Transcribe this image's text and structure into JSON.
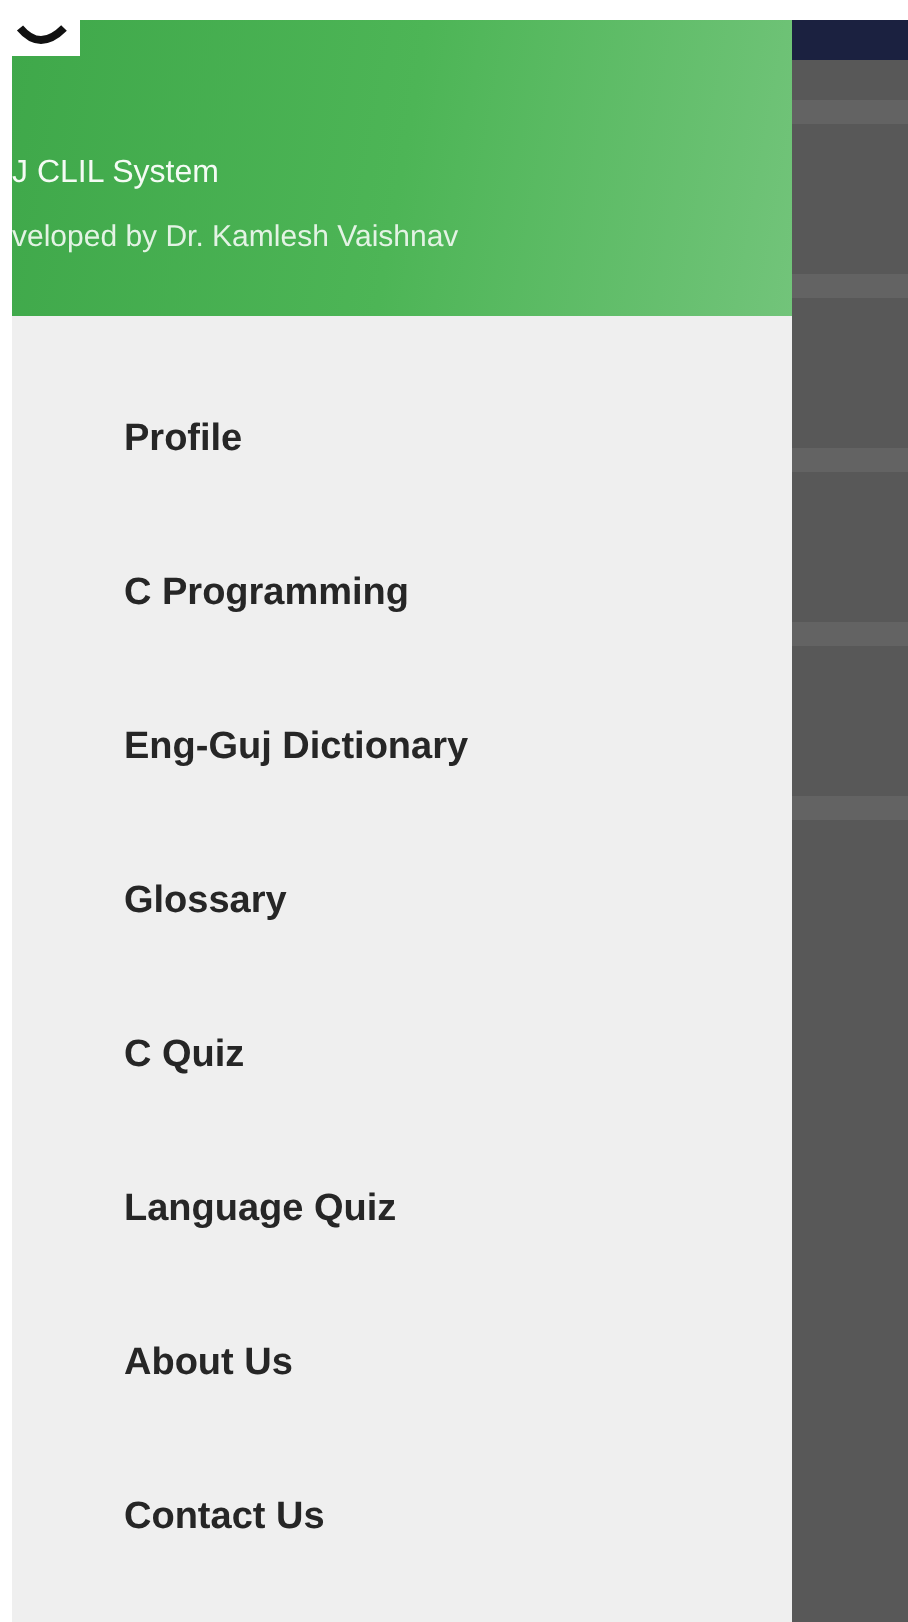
{
  "drawer": {
    "header": {
      "title": "J CLIL System",
      "subtitle": "veloped by Dr. Kamlesh Vaishnav"
    },
    "items": [
      {
        "label": "Profile"
      },
      {
        "label": "C Programming"
      },
      {
        "label": "Eng-Guj Dictionary"
      },
      {
        "label": "Glossary"
      },
      {
        "label": "C Quiz"
      },
      {
        "label": "Language Quiz"
      },
      {
        "label": "About Us"
      },
      {
        "label": "Contact Us"
      }
    ]
  }
}
